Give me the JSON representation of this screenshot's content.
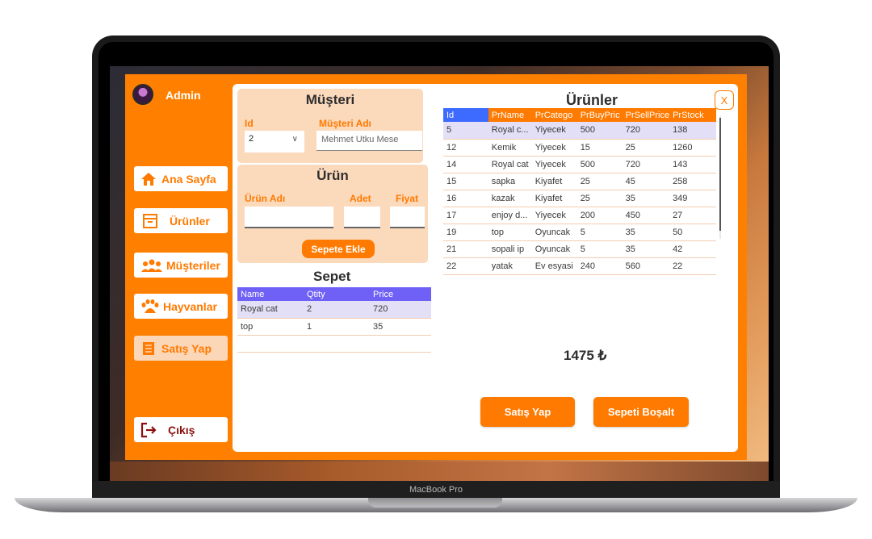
{
  "device": {
    "label": "MacBook Pro"
  },
  "sidebar": {
    "user": "Admin",
    "items": [
      {
        "label": "Ana Sayfa",
        "icon": "home-icon"
      },
      {
        "label": "Ürünler",
        "icon": "archive-box-icon"
      },
      {
        "label": "Müşteriler",
        "icon": "users-icon"
      },
      {
        "label": "Hayvanlar",
        "icon": "paw-icon"
      },
      {
        "label": "Satış Yap",
        "icon": "receipt-icon"
      }
    ],
    "exit_label": "Çıkış"
  },
  "musteri": {
    "title": "Müşteri",
    "id_label": "Id",
    "name_label": "Müşteri Adı",
    "id_value": "2",
    "name_value": "Mehmet Utku Mese"
  },
  "urun_form": {
    "title": "Ürün",
    "name_label": "Ürün Adı",
    "qty_label": "Adet",
    "price_label": "Fiyat",
    "add_button": "Sepete Ekle"
  },
  "sepet": {
    "title": "Sepet",
    "columns": [
      "Name",
      "Qtity",
      "Price"
    ],
    "rows": [
      [
        "Royal cat",
        "2",
        "720"
      ],
      [
        "top",
        "1",
        "35"
      ]
    ]
  },
  "urunler": {
    "title": "Ürünler",
    "columns": [
      "Id",
      "PrName",
      "PrCatego",
      "PrBuyPric",
      "PrSellPrice",
      "PrStock"
    ],
    "rows": [
      [
        "5",
        "Royal c...",
        "Yiyecek",
        "500",
        "720",
        "138"
      ],
      [
        "12",
        "Kemik",
        "Yiyecek",
        "15",
        "25",
        "1260"
      ],
      [
        "14",
        "Royal cat",
        "Yiyecek",
        "500",
        "720",
        "143"
      ],
      [
        "15",
        "sapka",
        "Kiyafet",
        "25",
        "45",
        "258"
      ],
      [
        "16",
        "kazak",
        "Kiyafet",
        "25",
        "35",
        "349"
      ],
      [
        "17",
        "enjoy d...",
        "Yiyecek",
        "200",
        "450",
        "27"
      ],
      [
        "19",
        "top",
        "Oyuncak",
        "5",
        "35",
        "50"
      ],
      [
        "21",
        "sopali ip",
        "Oyuncak",
        "5",
        "35",
        "42"
      ],
      [
        "22",
        "yatak",
        "Ev esyasi",
        "240",
        "560",
        "22"
      ]
    ]
  },
  "total": "1475 ₺",
  "actions": {
    "sell": "Satış Yap",
    "clear": "Sepeti Boşalt",
    "close": "X"
  },
  "colors": {
    "accent": "#ff8000",
    "card": "#fbd9bb",
    "sepet_header": "#7061f6",
    "id_header": "#3d6bff"
  }
}
